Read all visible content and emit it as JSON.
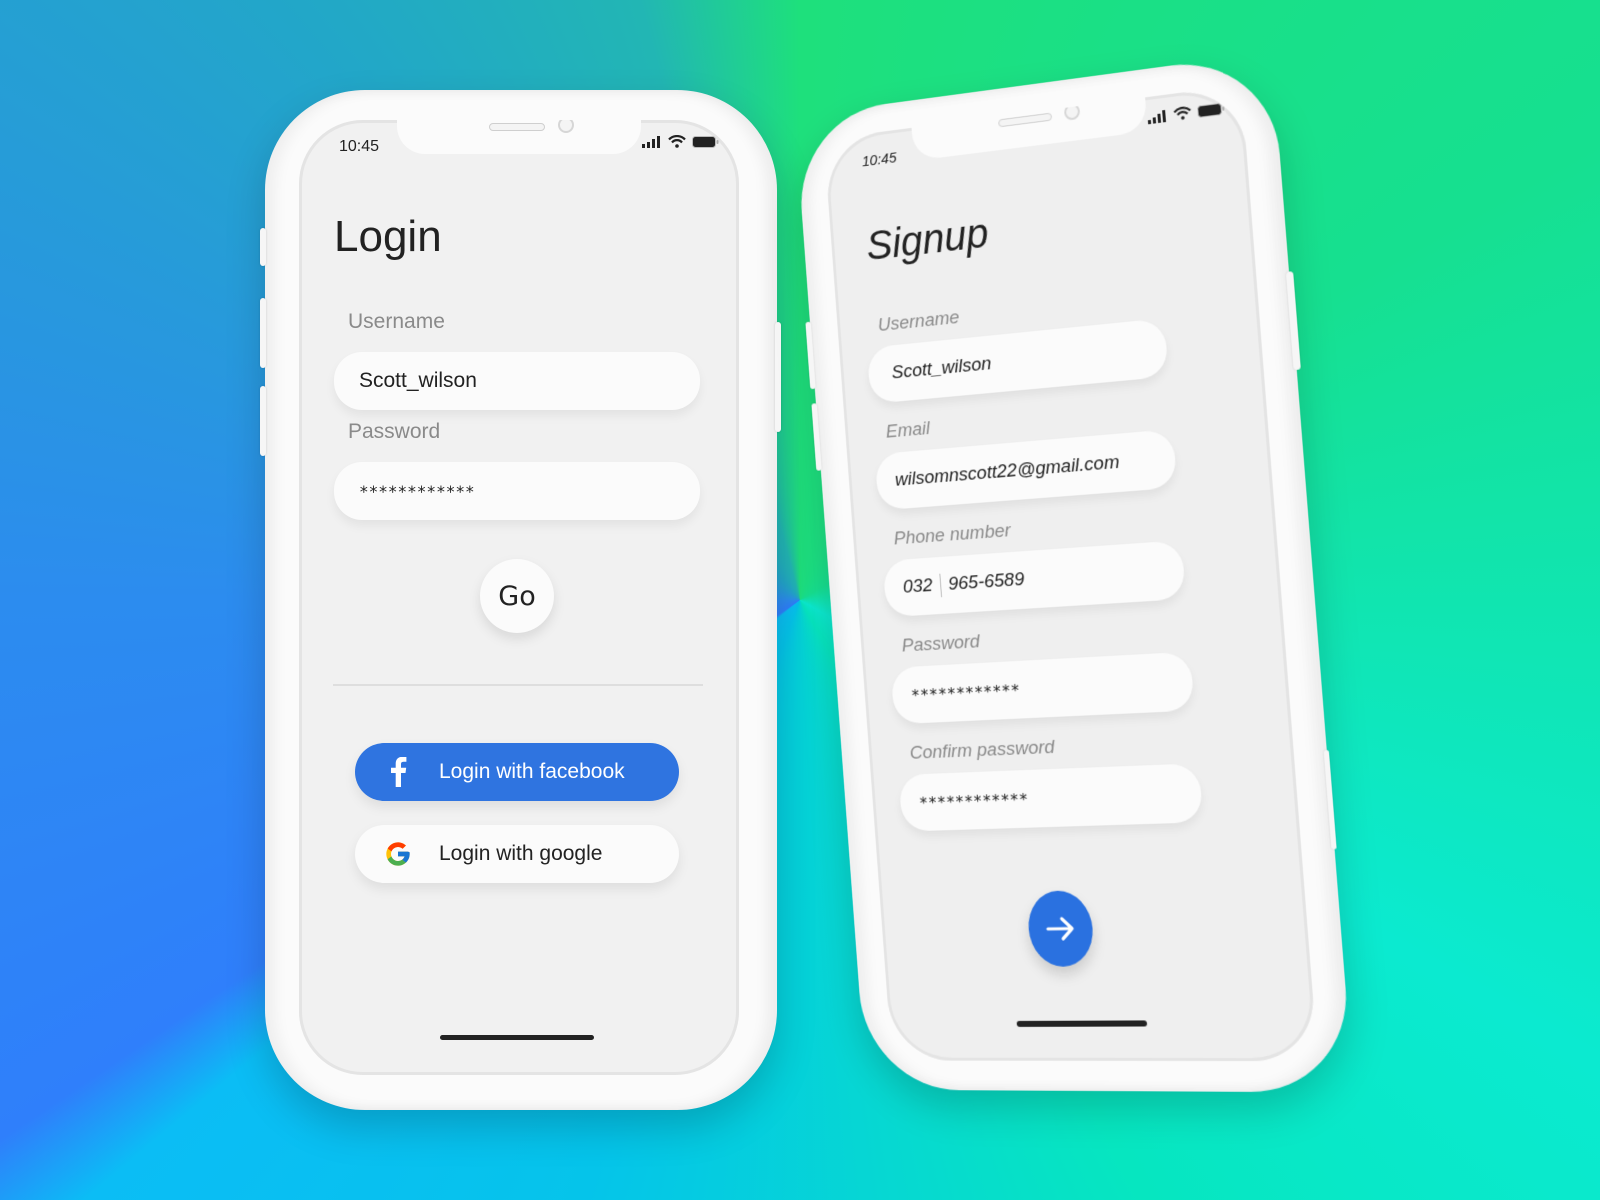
{
  "colors": {
    "accent_blue": "#2f74e0",
    "screen_bg": "#f1f1f1",
    "field_bg": "#fbfbfb",
    "text_dark": "#222222",
    "label_gray": "#8a8a8a"
  },
  "login_phone": {
    "status_bar": {
      "time": "10:45",
      "icons": [
        "signal-icon",
        "wifi-icon",
        "battery-icon"
      ]
    },
    "title": "Login",
    "fields": [
      {
        "label": "Username",
        "value": "Scott_wilson"
      },
      {
        "label": "Password",
        "value": "************"
      }
    ],
    "submit_label": "Go",
    "social_buttons": [
      {
        "label": "Login with facebook",
        "icon": "facebook-icon"
      },
      {
        "label": "Login with google",
        "icon": "google-icon"
      }
    ]
  },
  "signup_phone": {
    "status_bar": {
      "time": "10:45",
      "icons": [
        "signal-icon",
        "wifi-icon",
        "battery-icon"
      ]
    },
    "title": "Signup",
    "fields": [
      {
        "label": "Username",
        "value": "Scott_wilson"
      },
      {
        "label": "Email",
        "value": "wilsomnscott22@gmail.com"
      },
      {
        "label": "Phone number",
        "area_code": "032",
        "value": "965-6589"
      },
      {
        "label": "Password",
        "value": "************"
      },
      {
        "label": "Confirm password",
        "value": "************"
      }
    ],
    "submit_icon": "arrow-right-icon"
  }
}
